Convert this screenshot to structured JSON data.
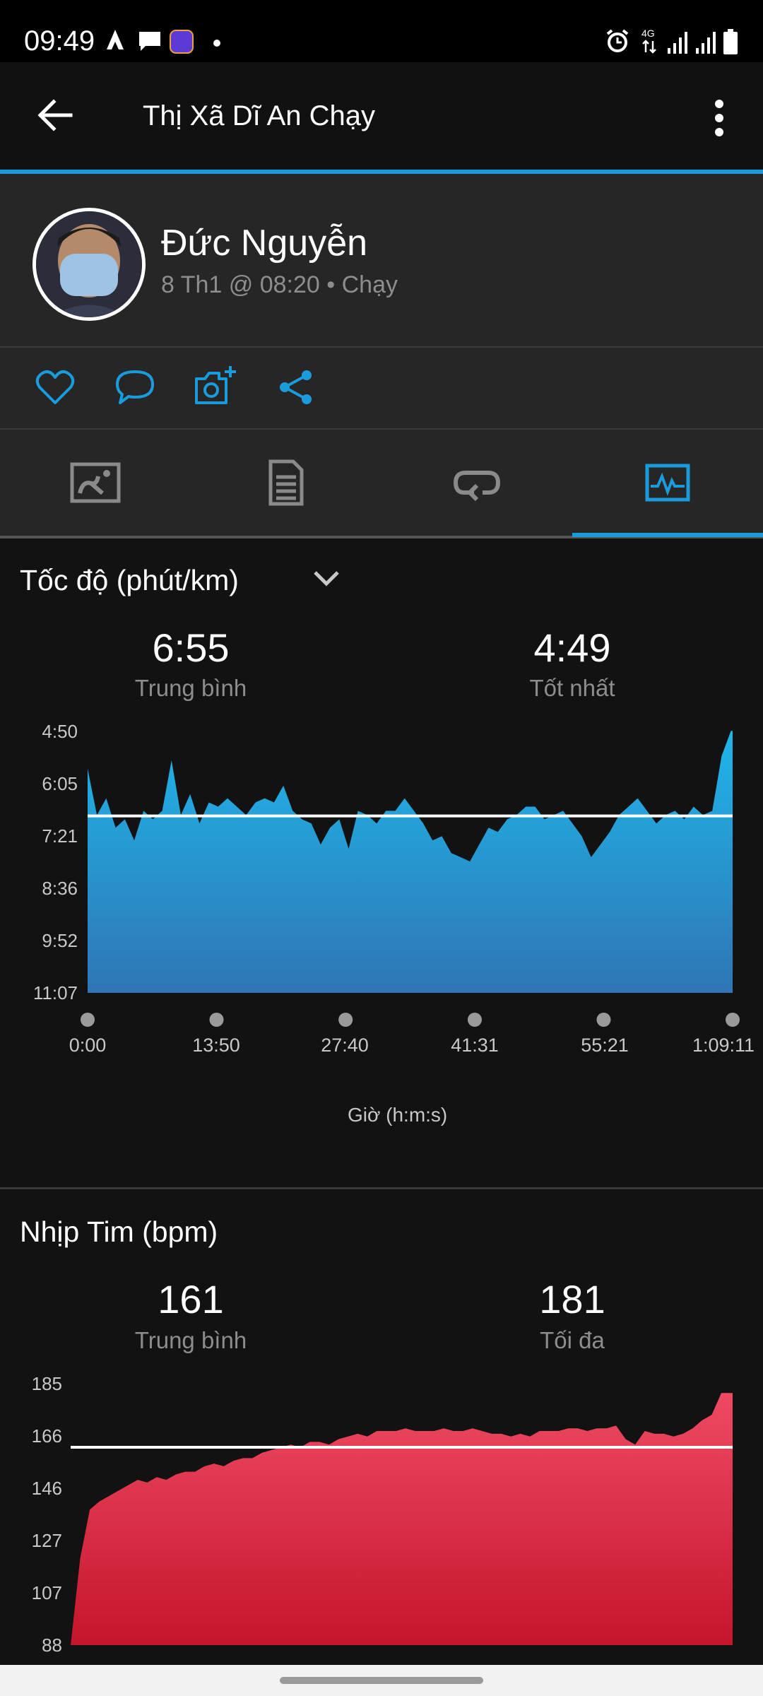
{
  "status_bar": {
    "time": "09:49",
    "icons": [
      "strava-icon",
      "chat-icon",
      "lazada-icon",
      "dot-icon",
      "alarm-icon",
      "4g-icon",
      "signal-icon",
      "signal-icon",
      "battery-icon"
    ]
  },
  "app_bar": {
    "title": "Thị Xã Dĩ An Chạy"
  },
  "header": {
    "name": "Đức Nguyễn",
    "meta": "8 Th1 @ 08:20 • Chạy"
  },
  "actions": [
    "like-icon",
    "comment-icon",
    "add-photo-icon",
    "share-icon"
  ],
  "tabs": {
    "selected": 3,
    "items": [
      "map-tab",
      "details-tab",
      "laps-tab",
      "charts-tab"
    ]
  },
  "colors": {
    "accent": "#1a9bdc",
    "pace": "#1fb3e6",
    "heart": "#e73a55"
  },
  "pace_section": {
    "title": "Tốc độ (phút/km)",
    "avg_value": "6:55",
    "avg_label": "Trung bình",
    "best_value": "4:49",
    "best_label": "Tốt nhất",
    "y_ticks": [
      "4:50",
      "6:05",
      "7:21",
      "8:36",
      "9:52",
      "11:07"
    ],
    "x_ticks": [
      "0:00",
      "13:50",
      "27:40",
      "41:31",
      "55:21",
      "1:09:11"
    ],
    "x_title": "Giờ (h:m:s)"
  },
  "hr_section": {
    "title": "Nhịp Tim (bpm)",
    "avg_value": "161",
    "avg_label": "Trung bình",
    "max_value": "181",
    "max_label": "Tối đa",
    "y_ticks": [
      "185",
      "166",
      "146",
      "127",
      "107",
      "88"
    ]
  },
  "chart_data": [
    {
      "type": "area",
      "title": "Tốc độ (phút/km)",
      "xlabel": "Giờ (h:m:s)",
      "ylabel": "min/km",
      "x_unit": "minutes",
      "x_range": [
        0,
        69.18
      ],
      "y_range_min_per_km": [
        4.83,
        11.12
      ],
      "y_inverted": true,
      "average_line": 6.92,
      "x": [
        0,
        1,
        2,
        3,
        4,
        5,
        6,
        7,
        8,
        9,
        10,
        11,
        12,
        13,
        14,
        15,
        16,
        17,
        18,
        19,
        20,
        21,
        22,
        23,
        24,
        25,
        26,
        27,
        28,
        29,
        30,
        31,
        32,
        33,
        34,
        35,
        36,
        37,
        38,
        39,
        40,
        41,
        42,
        43,
        44,
        45,
        46,
        47,
        48,
        49,
        50,
        51,
        52,
        53,
        54,
        55,
        56,
        57,
        58,
        59,
        60,
        61,
        62,
        63,
        64,
        65,
        66,
        67,
        68,
        69
      ],
      "values": [
        5.8,
        6.9,
        6.5,
        7.2,
        7.0,
        7.5,
        6.8,
        7.0,
        6.8,
        5.6,
        6.9,
        6.4,
        7.1,
        6.6,
        6.7,
        6.5,
        6.7,
        6.9,
        6.6,
        6.5,
        6.6,
        6.2,
        6.8,
        7.0,
        7.1,
        7.6,
        7.2,
        7.0,
        7.7,
        6.8,
        6.9,
        7.1,
        6.8,
        6.8,
        6.5,
        6.8,
        7.1,
        7.5,
        7.4,
        7.8,
        7.9,
        8.0,
        7.6,
        7.2,
        7.3,
        7.0,
        6.9,
        6.7,
        6.7,
        7.0,
        6.9,
        6.8,
        7.1,
        7.4,
        7.9,
        7.6,
        7.3,
        6.9,
        6.7,
        6.5,
        6.8,
        7.1,
        6.9,
        6.8,
        7.0,
        6.7,
        6.9,
        6.8,
        5.5,
        4.9
      ]
    },
    {
      "type": "area",
      "title": "Nhịp Tim (bpm)",
      "ylabel": "bpm",
      "x_unit": "minutes",
      "x_range": [
        0,
        69.18
      ],
      "y_range": [
        88,
        185
      ],
      "average_line": 161,
      "x": [
        0,
        1,
        2,
        3,
        4,
        5,
        6,
        7,
        8,
        9,
        10,
        11,
        12,
        13,
        14,
        15,
        16,
        17,
        18,
        19,
        20,
        21,
        22,
        23,
        24,
        25,
        26,
        27,
        28,
        29,
        30,
        31,
        32,
        33,
        34,
        35,
        36,
        37,
        38,
        39,
        40,
        41,
        42,
        43,
        44,
        45,
        46,
        47,
        48,
        49,
        50,
        51,
        52,
        53,
        54,
        55,
        56,
        57,
        58,
        59,
        60,
        61,
        62,
        63,
        64,
        65,
        66,
        67,
        68,
        69
      ],
      "values": [
        88,
        120,
        138,
        141,
        143,
        145,
        147,
        149,
        148,
        150,
        149,
        151,
        152,
        152,
        154,
        155,
        154,
        156,
        157,
        157,
        159,
        160,
        161,
        162,
        161,
        163,
        163,
        162,
        164,
        165,
        166,
        165,
        167,
        167,
        167,
        168,
        167,
        167,
        167,
        168,
        167,
        167,
        168,
        167,
        166,
        166,
        165,
        166,
        165,
        167,
        167,
        167,
        168,
        168,
        167,
        168,
        168,
        169,
        164,
        162,
        167,
        166,
        166,
        165,
        166,
        168,
        171,
        173,
        181,
        181
      ]
    }
  ]
}
